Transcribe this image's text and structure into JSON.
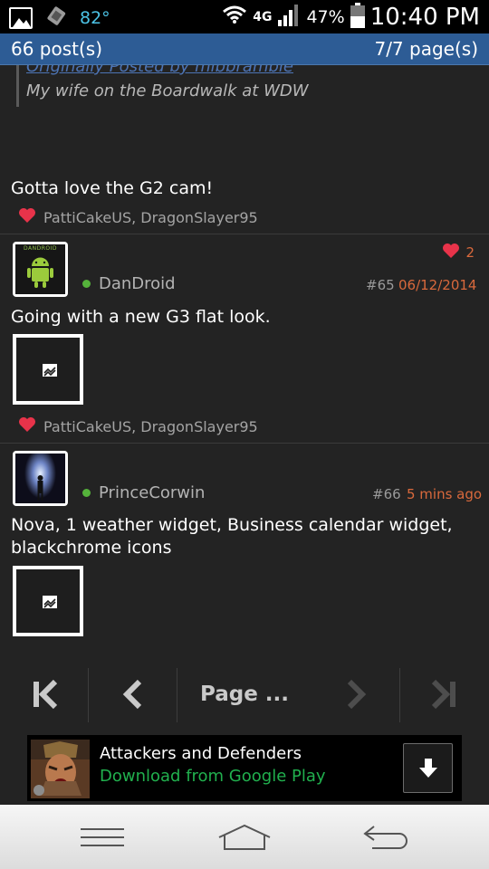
{
  "status_bar": {
    "temperature": "82°",
    "network": "4G",
    "battery": "47%",
    "time": "10:40 PM"
  },
  "header": {
    "posts_count": "66 post(s)",
    "page_count": "7/7 page(s)"
  },
  "previous_post": {
    "quote_origin": "Originally Posted by mlbbramble",
    "quote_text": "My wife on the Boardwalk at WDW",
    "message": "Gotta love the G2 cam!",
    "liked_by": "PattiCakeUS, DragonSlayer95"
  },
  "posts": [
    {
      "avatar_label": "DANDROID",
      "username": "DanDroid",
      "post_number": "#65",
      "date": "06/12/2014",
      "like_count": "2",
      "message": "Going with a new G3 flat look.",
      "liked_by": "PattiCakeUS, DragonSlayer95"
    },
    {
      "username": "PrinceCorwin",
      "post_number": "#66",
      "date": "5 mins ago",
      "message_line1": "Nova, 1 weather widget, Business calendar widget,",
      "message_line2": "blackchrome icons"
    }
  ],
  "pager": {
    "page_label": "Page ..."
  },
  "ad": {
    "title": "Attackers and Defenders",
    "subtitle": "Download from Google Play"
  },
  "colors": {
    "header_bg": "#2d5c95",
    "accent_orange": "#d9693c",
    "online_green": "#55b33b",
    "play_green": "#21b04e",
    "heart_red": "#e8334a"
  }
}
